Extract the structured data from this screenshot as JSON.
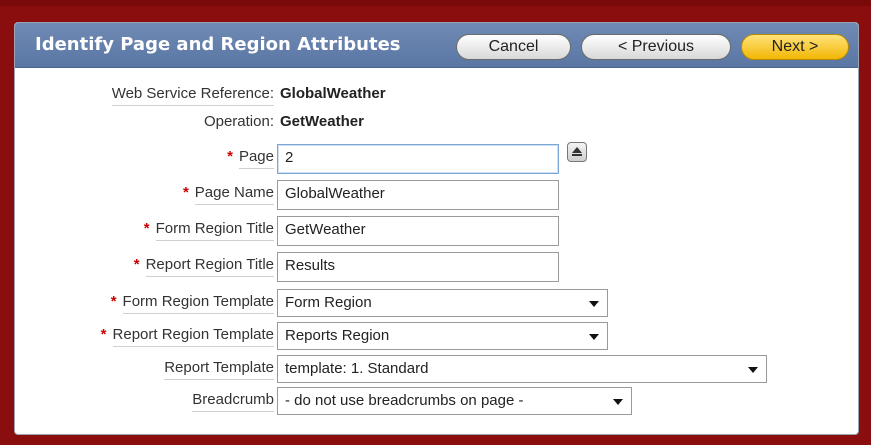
{
  "header": {
    "title": "Identify Page and Region Attributes",
    "cancel_label": "Cancel",
    "previous_label": "< Previous",
    "next_label": "Next >"
  },
  "form": {
    "required_marker": "*",
    "web_service_reference": {
      "label": "Web Service Reference:",
      "value": "GlobalWeather"
    },
    "operation": {
      "label": "Operation:",
      "value": "GetWeather"
    },
    "page": {
      "label": "Page",
      "value": "2"
    },
    "page_name": {
      "label": "Page Name",
      "value": "GlobalWeather"
    },
    "form_region_title": {
      "label": "Form Region Title",
      "value": "GetWeather"
    },
    "report_region_title": {
      "label": "Report Region Title",
      "value": "Results"
    },
    "form_region_template": {
      "label": "Form Region Template",
      "value": "Form Region"
    },
    "report_region_template": {
      "label": "Report Region Template",
      "value": "Reports Region"
    },
    "report_template": {
      "label": "Report Template",
      "value": "template: 1. Standard"
    },
    "breadcrumb": {
      "label": "Breadcrumb",
      "value": "- do not use breadcrumbs on page -"
    }
  },
  "icons": {
    "page_popup": "popup-list-icon",
    "dropdown": "chevron-down-icon"
  },
  "colors": {
    "frame": "#8b0e0e",
    "header": "#5f7aa8",
    "next_button": "#f5c42c",
    "required": "#cc0000"
  }
}
